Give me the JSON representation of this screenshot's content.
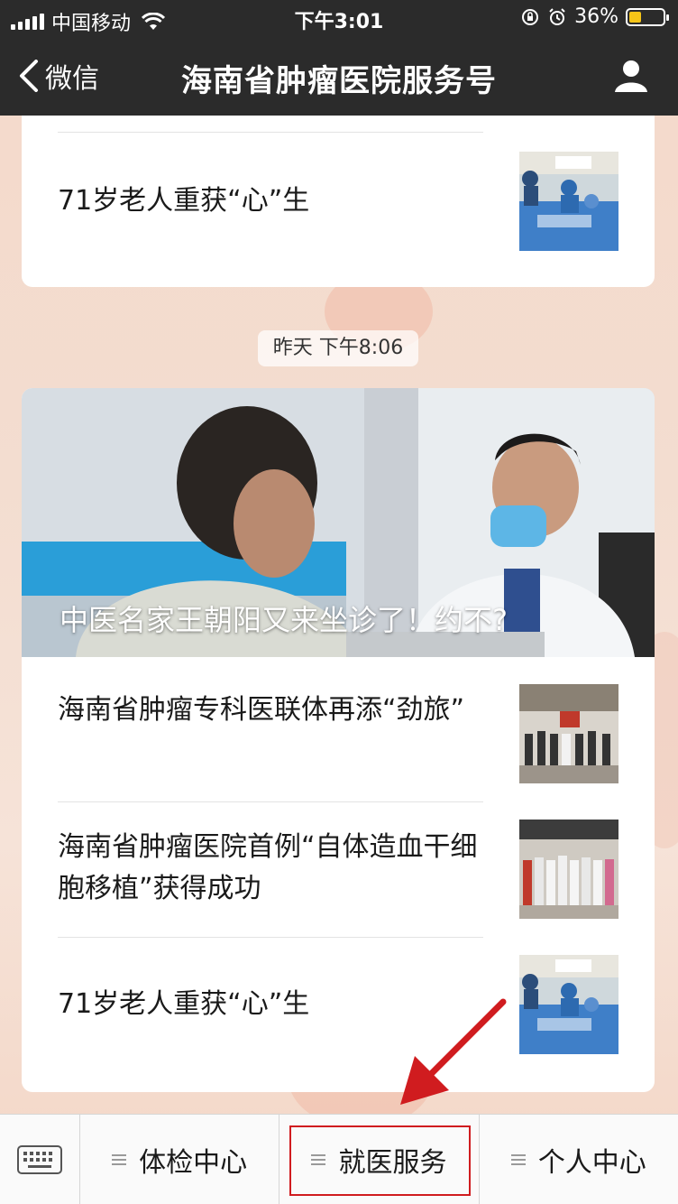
{
  "status_bar": {
    "carrier": "中国移动",
    "time": "下午3:01",
    "battery_percent": "36%",
    "battery_level": 0.36
  },
  "nav": {
    "back_label": "微信",
    "title": "海南省肿瘤医院服务号"
  },
  "top_card": {
    "article_title": "71岁老人重获“心”生"
  },
  "timestamp": "昨天 下午8:06",
  "main_card": {
    "hero_title": "中医名家王朝阳又来坐诊了！约不?",
    "articles": [
      {
        "title": "海南省肿瘤专科医联体再添“劲旅”"
      },
      {
        "title": "海南省肿瘤医院首例“自体造血干细胞移植”获得成功"
      },
      {
        "title": "71岁老人重获“心”生"
      }
    ]
  },
  "bottom_menu": {
    "items": [
      {
        "label": "体检中心"
      },
      {
        "label": "就医服务"
      },
      {
        "label": "个人中心"
      }
    ]
  },
  "colors": {
    "bar_dark": "#2b2b2b",
    "highlight_red": "#d01c1f",
    "battery_yellow": "#f5c518"
  }
}
